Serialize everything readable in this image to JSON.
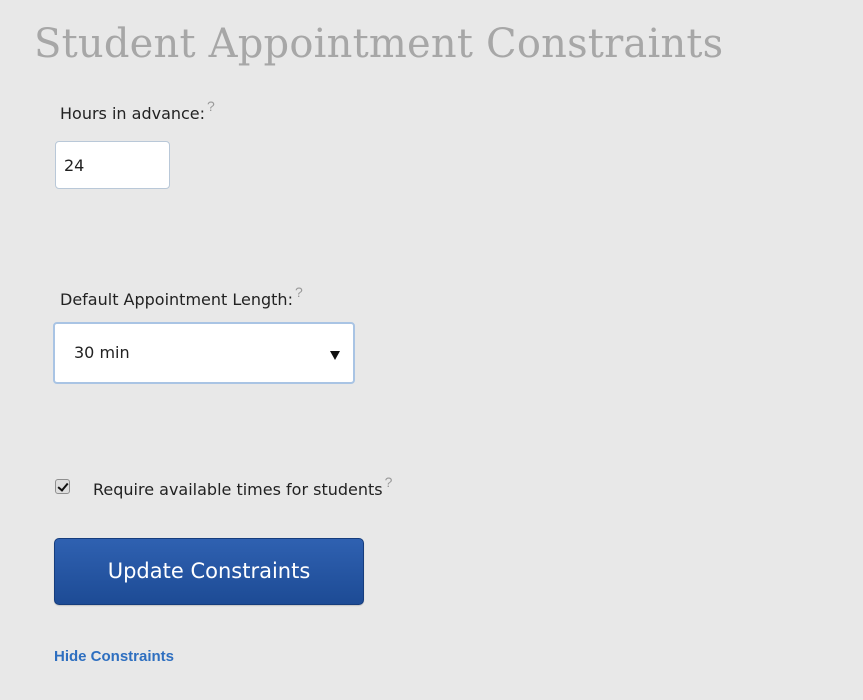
{
  "section": {
    "title": "Student Appointment Constraints"
  },
  "hours_in_advance": {
    "label": "Hours in advance:",
    "help": "?",
    "value": "24"
  },
  "appointment_length": {
    "label": "Default Appointment Length:",
    "help": "?",
    "selected": "30 min"
  },
  "require_available_times": {
    "label": "Require available times for students",
    "help": "?",
    "checked": true
  },
  "actions": {
    "update_label": "Update Constraints",
    "hide_link": "Hide Constraints"
  },
  "colors": {
    "background": "#e8e8e8",
    "title": "#a7a7a7",
    "button": "#2554a3",
    "link": "#2e6fc0"
  }
}
